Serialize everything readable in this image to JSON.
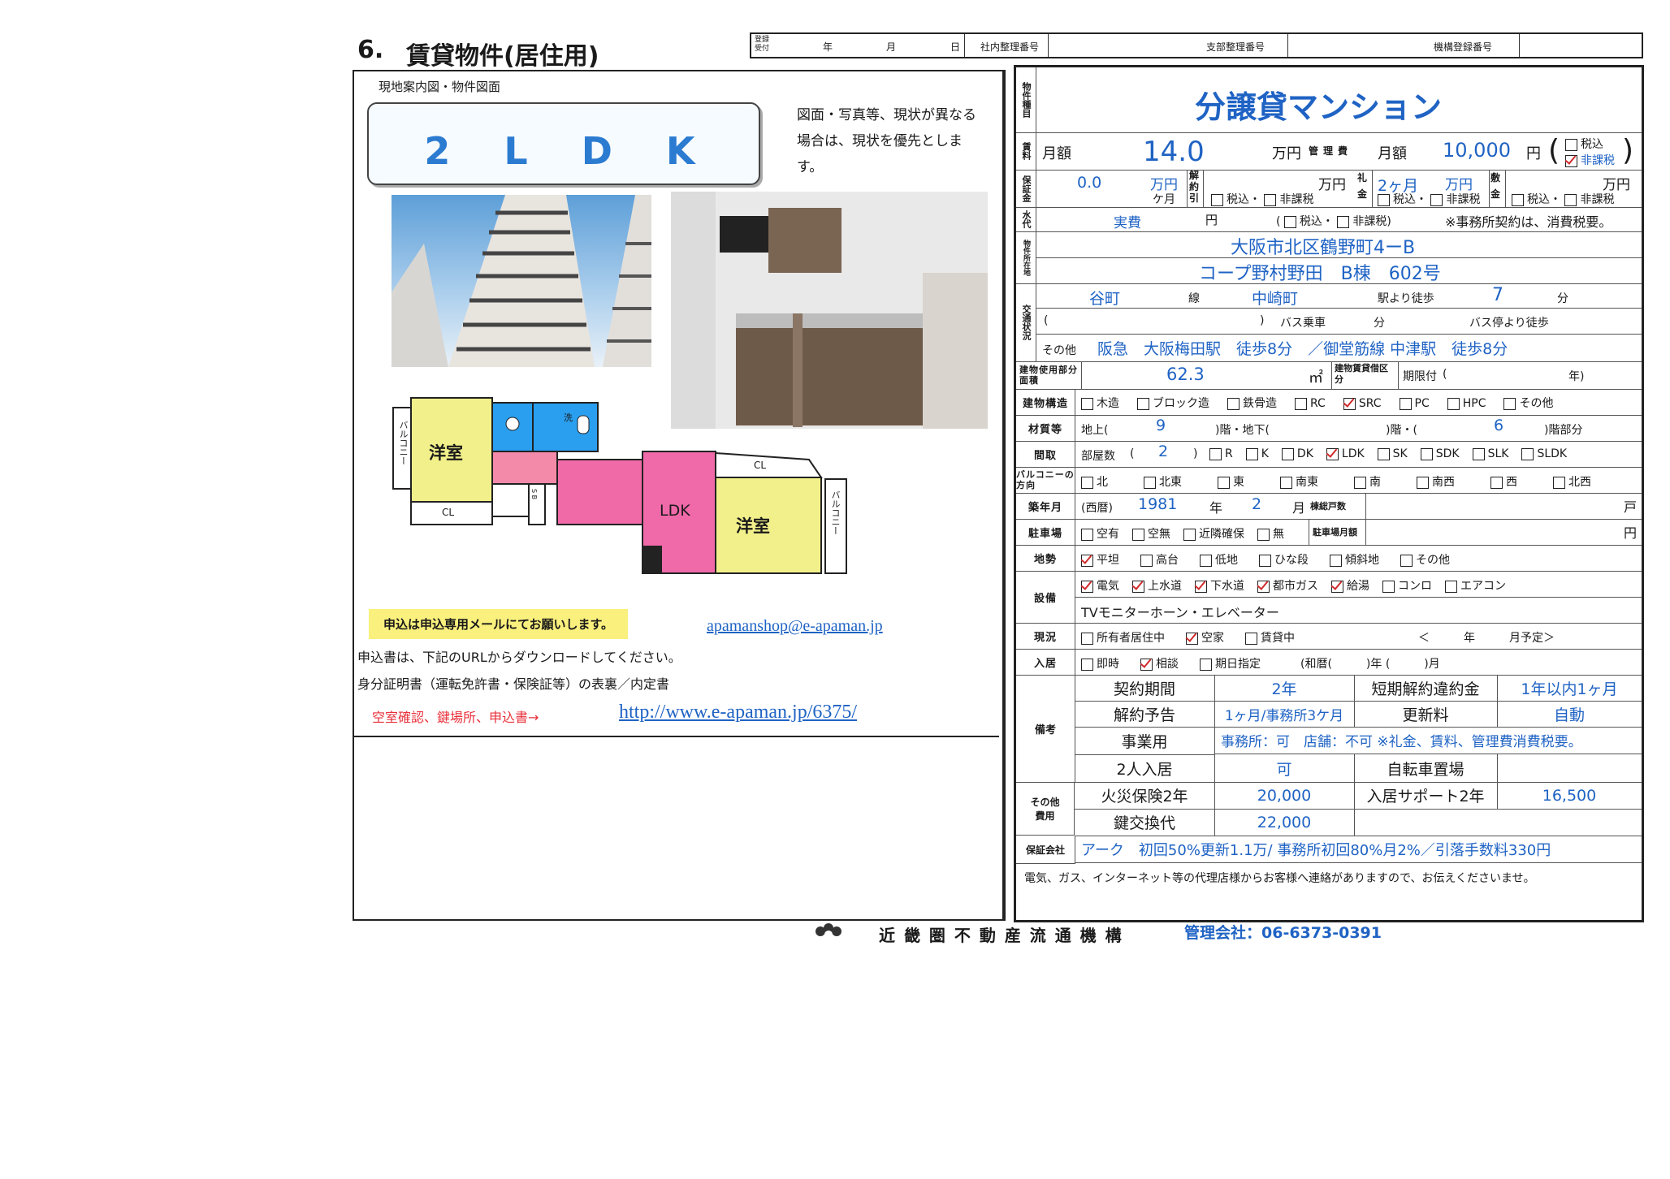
{
  "header": {
    "number": "6.",
    "title": "賃貸物件(居住用)",
    "reg_label": "登録受付",
    "year": "年",
    "month": "月",
    "day": "日",
    "internal_no": "社内整理番号",
    "branch_no": "支部整理番号",
    "org_no": "機構登録番号"
  },
  "left": {
    "map_label": "現地案内図・物件図面",
    "layout_type": "2　L　D　K",
    "note": "図面・写真等、現状が異なる場合は、現状を優先とします。",
    "apply_note": "申込は申込専用メールにてお願いします。",
    "email": "apamanshop@e-apaman.jp",
    "download_note": "申込書は、下記のURLからダウンロードしてください。",
    "id_note": "身分証明書（運転免許書・保険証等）の表裏／内定書",
    "vacancy_note": "空室確認、鍵場所、申込書→",
    "url": "http://www.e-apaman.jp/6375/",
    "floorplan": {
      "room1": "洋室",
      "room2": "洋室",
      "ldk": "LDK",
      "cl1": "CL",
      "cl2": "CL",
      "balcony": "バルコニー",
      "wash": "洗",
      "sb": "S B"
    }
  },
  "right": {
    "type_label": "物件種目",
    "type": "分譲貸マンション",
    "rent_label": "賃料",
    "monthly": "月額",
    "rent": "14.0",
    "man_yen": "万円",
    "mgmt_label": "管理費",
    "mgmt_monthly": "月額",
    "mgmt_fee": "10,000",
    "yen": "円",
    "tax_in": "税込",
    "tax_ex": "非課税",
    "deposit_label": "保証金",
    "deposit": "0.0",
    "kagetsu": "ケ月",
    "kaiyaku_label": "解約引",
    "reikin_label": "礼金",
    "reikin": "2ヶ月",
    "shikikin_label": "敷金",
    "water_label": "水代",
    "water": "実費",
    "water_note": "※事務所契約は、消費税要。",
    "address_label": "物件所在地",
    "address1": "大阪市北区鶴野町4ーB",
    "address2": "コープ野村野田　B棟　602号",
    "traffic_label": "交通状況",
    "line": "谷町",
    "line_suffix": "線",
    "station": "中崎町",
    "walk_label": "駅より徒歩",
    "walk": "7",
    "min": "分",
    "bus_ride": "バス乗車",
    "bus_walk": "バス停より徒歩",
    "other_label": "その他",
    "other_access": "阪急　大阪梅田駅　徒歩8分　／御堂筋線 中津駅　徒歩8分",
    "area_label": "建物使用部分面積",
    "area": "62.3",
    "sqm": "㎡",
    "lease_label": "建物賃貸借区分",
    "lease_type": "期限付",
    "lease_year": "年)",
    "structure_label": "建物構造",
    "structures": [
      "木造",
      "ブロック造",
      "鉄骨造",
      "RC",
      "SRC",
      "PC",
      "HPC",
      "その他"
    ],
    "floors_label": "材質等",
    "above": "地上(",
    "floors": "9",
    "kai": ")階・地下(",
    "kai2": ")階・(",
    "floor_part": "6",
    "kai_part": ")階部分",
    "layout_label": "間取",
    "rooms_label": "部屋数",
    "rooms": "2",
    "layouts": [
      "R",
      "K",
      "DK",
      "LDK",
      "SK",
      "SDK",
      "SLK",
      "SLDK"
    ],
    "balcony_label": "バルコニーの方向",
    "directions": [
      "北",
      "北東",
      "東",
      "南東",
      "南",
      "南西",
      "西",
      "北西"
    ],
    "built_label": "築年月",
    "era": "(西暦)",
    "built_year": "1981",
    "nen": "年",
    "built_month": "2",
    "tsuki": "月",
    "units_label": "棟総戸数",
    "ko": "戸",
    "parking_label": "駐車場",
    "parking": [
      "空有",
      "空無",
      "近隣確保",
      "無"
    ],
    "parking_fee_label": "駐車場月額",
    "en": "円",
    "terrain_label": "地勢",
    "terrain": [
      "平坦",
      "高台",
      "低地",
      "ひな段",
      "傾斜地",
      "その他"
    ],
    "facilities_label": "設備",
    "facilities": [
      "電気",
      "上水道",
      "下水道",
      "都市ガス",
      "給湯",
      "コンロ",
      "エアコン"
    ],
    "facilities_extra": "TVモニターホーン・エレベーター",
    "status_label": "現況",
    "status": [
      "所有者居住中",
      "空家",
      "賃貸中"
    ],
    "status_plan": "＜　　　年　　　月予定＞",
    "move_label": "入居",
    "move": [
      "即時",
      "相談",
      "期日指定"
    ],
    "move_extra": "(和暦(　　　)年 (　　　)月",
    "remarks_label": "備考",
    "contract_period_label": "契約期間",
    "contract_period": "2年",
    "short_penalty_label": "短期解約違約金",
    "short_penalty": "1年以内1ヶ月",
    "notice_label": "解約予告",
    "notice": "1ヶ月/事務所3ケ月",
    "renewal_label": "更新料",
    "renewal": "自動",
    "business_label": "事業用",
    "business": "事務所：可　店舗：不可 ※礼金、賃料、管理費消費税要。",
    "two_label": "2人入居",
    "two": "可",
    "bike_label": "自転車置場",
    "other_cost_label": "その他費用",
    "fire_label": "火災保険2年",
    "fire": "20,000",
    "support_label": "入居サポート2年",
    "support": "16,500",
    "key_label": "鍵交換代",
    "key": "22,000",
    "guarantee_label": "保証会社",
    "guarantee": "アーク　初回50%更新1.1万/ 事務所初回80%月2%／引落手数料330円",
    "footer_note": "電気、ガス、インターネット等の代理店様からお客様へ連絡がありますので、お伝えくださいませ。"
  },
  "footer": {
    "org": "近 畿 圏 不 動 産 流 通 機 構",
    "company": "管理会社：06-6373-0391"
  }
}
